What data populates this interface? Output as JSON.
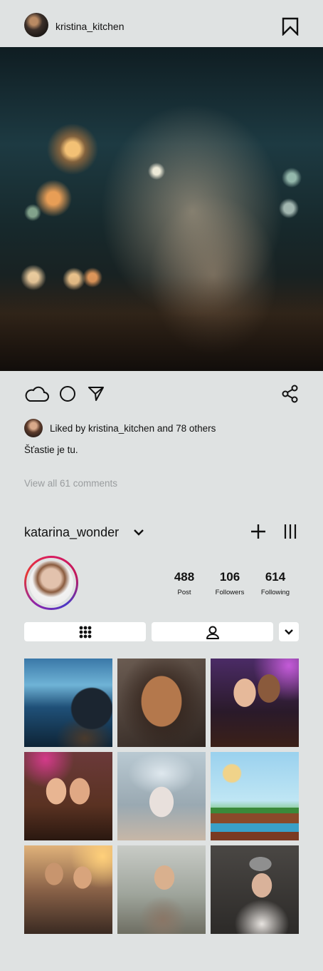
{
  "post": {
    "username": "kristina_kitchen",
    "liked_by_text": "Liked by kristina_kitchen and 78 others",
    "caption": "Šťastie je tu.",
    "view_comments": "View all 61 comments"
  },
  "profile": {
    "username": "katarina_wonder",
    "stats": [
      {
        "value": "488",
        "label": "Post"
      },
      {
        "value": "106",
        "label": "Followers"
      },
      {
        "value": "614",
        "label": "Following"
      }
    ]
  },
  "icons": {
    "bookmark": "bookmark-icon",
    "like": "cloud-icon",
    "comment": "circle-icon",
    "send": "send-icon",
    "share": "share-icon",
    "add": "plus-icon",
    "menu": "menu-icon",
    "grid_tab": "grid-icon",
    "tagged_tab": "person-icon",
    "more": "chevron-down-icon"
  },
  "grid_thumbnails": [
    "gamer-with-headphones",
    "smiling-woman-portrait",
    "two-friends-at-party",
    "two-girls-selfie",
    "floral-makeup-portrait",
    "platform-game-screenshot",
    "couple-sunset-selfie",
    "boy-taking-selfie",
    "girl-with-beanie-selfie"
  ],
  "colors": {
    "background": "#dfe2e2",
    "text": "#111111",
    "muted_text": "#9a9d9f",
    "ring_start": "#d81b60",
    "ring_end": "#4a38c6"
  }
}
